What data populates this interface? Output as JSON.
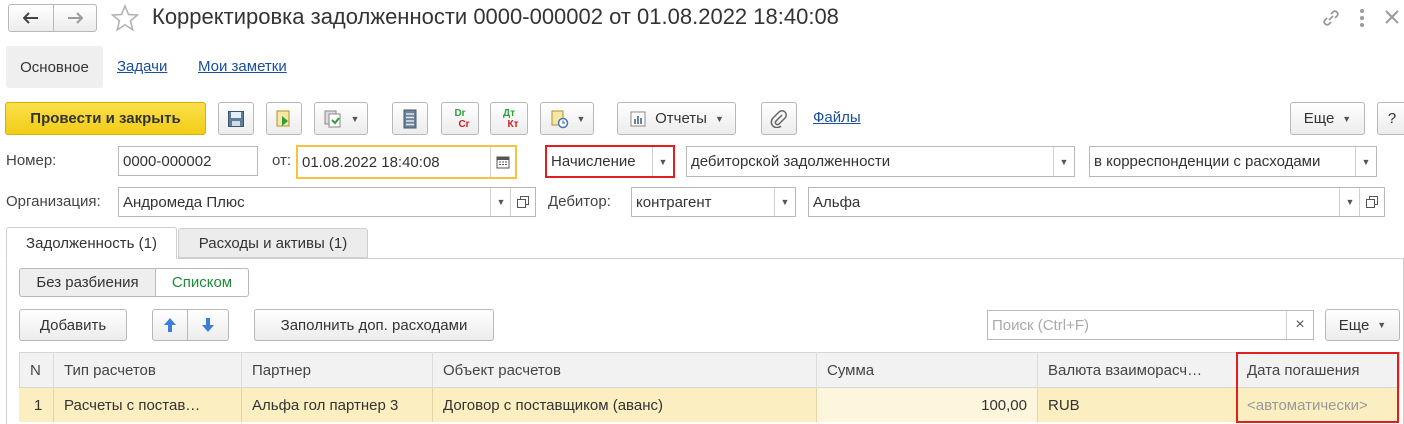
{
  "window": {
    "title": "Корректировка задолженности 0000-000002 от 01.08.2022 18:40:08"
  },
  "nav_tabs": [
    {
      "label": "Основное",
      "active": true
    },
    {
      "label": "Задачи"
    },
    {
      "label": "Мои заметки"
    }
  ],
  "toolbar": {
    "post_close_label": "Провести и закрыть",
    "dr_top": "Dr",
    "dr_bottom": "Cr",
    "dt_top": "Дт",
    "dt_bottom": "Кт",
    "reports_label": "Отчеты",
    "files_label": "Файлы",
    "more_label": "Еще",
    "help_label": "?"
  },
  "form": {
    "number_label": "Номер:",
    "number_value": "0000-000002",
    "date_label": "от:",
    "date_value": "01.08.2022 18:40:08",
    "operation_value": "Начисление",
    "debt_type_value": "дебиторской задолженности",
    "correspondence_value": "в корреспонденции с расходами",
    "org_label": "Организация:",
    "org_value": "Андромеда Плюс",
    "debtor_label": "Дебитор:",
    "debtor_type_value": "контрагент",
    "debtor_value": "Альфа"
  },
  "content_tabs": [
    {
      "label": "Задолженность (1)",
      "active": true
    },
    {
      "label": "Расходы и активы (1)"
    }
  ],
  "mode_switch": {
    "option1": "Без разбиения",
    "option2": "Списком"
  },
  "table_toolbar": {
    "add_label": "Добавить",
    "fill_label": "Заполнить доп. расходами",
    "search_placeholder": "Поиск (Ctrl+F)",
    "clear_label": "×",
    "more_label": "Еще"
  },
  "table": {
    "columns": [
      "N",
      "Тип расчетов",
      "Партнер",
      "Объект расчетов",
      "Сумма",
      "Валюта взаиморасч…",
      "Дата погашения"
    ],
    "rows": [
      [
        "1",
        "Расчеты с постав…",
        "Альфа гол партнер 3",
        "Договор с поставщиком (аванс)",
        "100,00",
        "RUB",
        "<автоматически>"
      ]
    ]
  },
  "colors": {
    "accent_yellow": "#f5d21e",
    "highlight_red": "#e02020",
    "selected_row": "#fbeec0",
    "link": "#1a4fa0",
    "green_text": "#1e8a3a"
  }
}
